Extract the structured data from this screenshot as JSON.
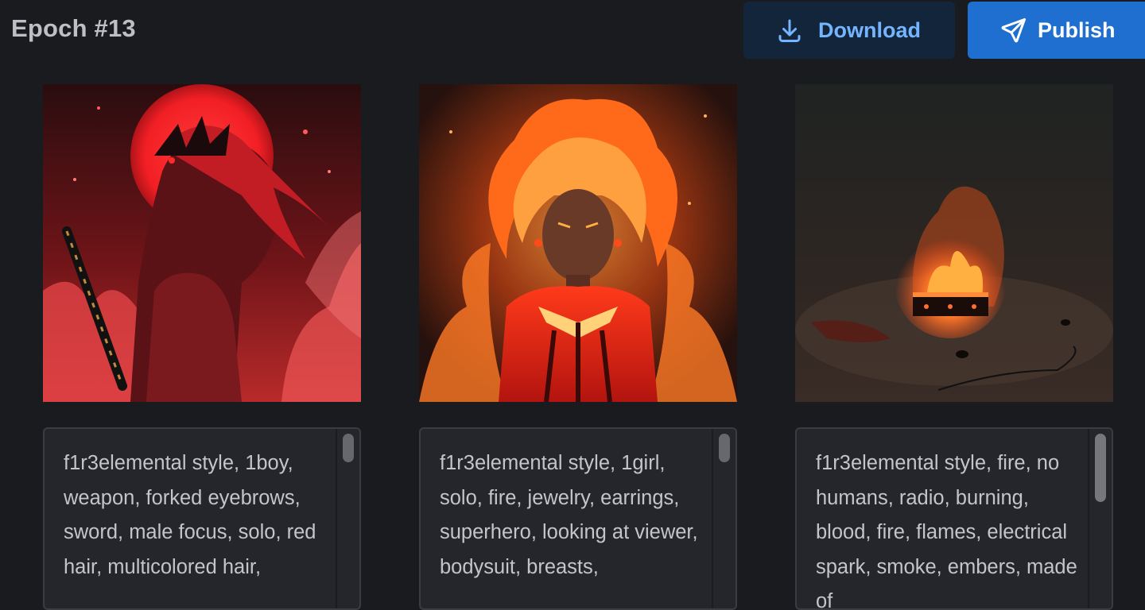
{
  "header": {
    "title": "Epoch #13",
    "download_label": "Download",
    "publish_label": "Publish",
    "download_icon": "download-icon",
    "publish_icon": "send-icon"
  },
  "colors": {
    "background": "#1a1b1e",
    "download_bg": "#13253a",
    "download_text": "#74b5ff",
    "publish_bg": "#1f6fd1",
    "caption_bg": "#25262b"
  },
  "cards": [
    {
      "image": "Anime man with red hair and katana before a red moon and flames",
      "caption": "f1r3elemental style, 1boy, weapon, forked eyebrows, sword, male focus, solo, red hair, multicolored hair,"
    },
    {
      "image": "Anime girl with flaming hair in a red bodysuit surrounded by fire",
      "caption": "f1r3elemental style, 1girl, solo, fire, jewelry, earrings, superhero, looking at viewer, bodysuit, breasts,"
    },
    {
      "image": "Burning radio on a dark ground with smoke and embers",
      "caption": "f1r3elemental style, fire, no humans, radio, burning, blood, fire, flames, electrical spark, smoke, embers, made of"
    }
  ]
}
